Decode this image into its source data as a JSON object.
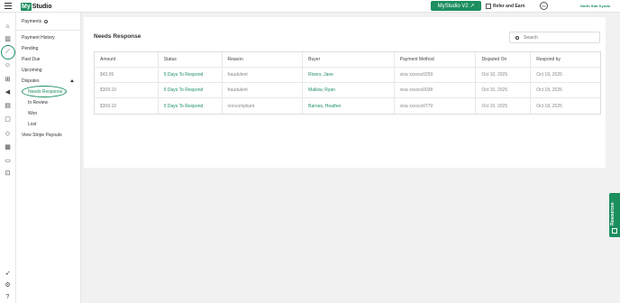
{
  "brand": {
    "logo_mark": "My",
    "logo_text": "Studio"
  },
  "topbar": {
    "version_button": "MyStudio V2 ↗",
    "refer_label": "Refer and Earn",
    "avatar_initials": "OO",
    "account_name": "North Star Kyudo"
  },
  "subnav": {
    "title": "Payments",
    "items": {
      "payment_history": "Payment History",
      "pending": "Pending",
      "past_due": "Past Due",
      "upcoming": "Upcoming",
      "disputes": "Disputes",
      "needs_response": "Needs Response",
      "in_review": "In Review",
      "won": "Won",
      "lost": "Lost",
      "view_stripe_payouts": "View Stripe Payouts"
    }
  },
  "main": {
    "title": "Needs Response",
    "search_placeholder": "Search",
    "columns": [
      "Amount",
      "Status",
      "Reason",
      "Buyer",
      "Payment Method",
      "Disputed On",
      "Respond by"
    ],
    "rows": [
      {
        "amount": "$43.95",
        "status": "5 Days To Respond",
        "reason": "fraudulent",
        "buyer": "Rivers, Jane",
        "method": "visa xxxxxx0259",
        "disputed_on": "Oct 10, 2025",
        "respond_by": "Oct 18, 2025"
      },
      {
        "amount": "$309.10",
        "status": "5 Days To Respond",
        "reason": "fraudulent",
        "buyer": "Mallow, Ryan",
        "method": "visa xxxxxx0038",
        "disputed_on": "Oct 10, 2025",
        "respond_by": "Oct 18, 2025"
      },
      {
        "amount": "$309.10",
        "status": "5 Days To Respond",
        "reason": "noncompliant",
        "buyer": "Barnes, Heather",
        "method": "visa xxxxxx0779",
        "disputed_on": "Oct 10, 2025",
        "respond_by": "Oct 18, 2025"
      }
    ]
  },
  "resources_tab": "Resources",
  "colors": {
    "accent": "#1c8f5f"
  },
  "icons": {
    "rail": [
      "home-icon",
      "chart-icon",
      "payments-icon",
      "people-icon",
      "grid-icon",
      "megaphone-icon",
      "document-icon",
      "clipboard-icon",
      "tag-icon",
      "store-icon",
      "image-icon",
      "apps-icon",
      "rocket-icon",
      "settings-icon",
      "help-icon"
    ]
  }
}
